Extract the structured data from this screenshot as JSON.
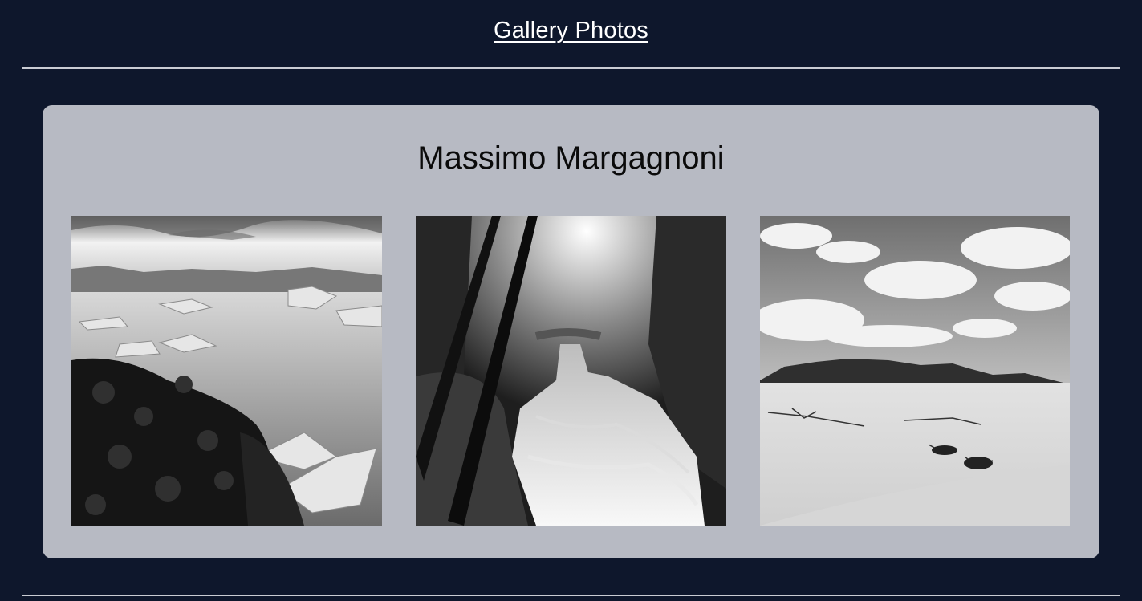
{
  "header": {
    "title": "Gallery Photos"
  },
  "gallery": {
    "photographer": "Massimo Margagnoni",
    "photos": [
      {
        "subject": "icy-lake-shore-photo"
      },
      {
        "subject": "forest-waterfall-photo"
      },
      {
        "subject": "desert-dunes-mountains-photo"
      }
    ]
  },
  "colors": {
    "background": "#0e172c",
    "card": "#b7bac3",
    "rule": "#c9ccd3",
    "title_text": "#ffffff"
  }
}
